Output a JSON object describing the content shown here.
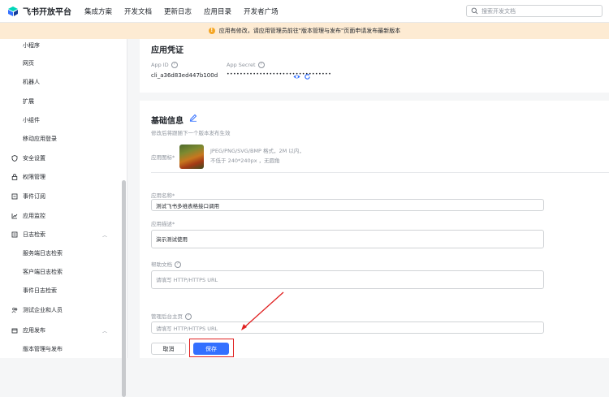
{
  "header": {
    "logo_text": "飞书开放平台",
    "nav": [
      "集成方案",
      "开发文档",
      "更新日志",
      "应用目录",
      "开发者广场"
    ],
    "search_placeholder": "搜索开发文档"
  },
  "notice": {
    "text": "应用有修改，请应用管理员前往\"版本管理与发布\"页面申请发布最新版本",
    "color": "#f5a623"
  },
  "sidebar": {
    "items": [
      {
        "label": "小程序",
        "icon": ""
      },
      {
        "label": "网页",
        "icon": ""
      },
      {
        "label": "机器人",
        "icon": ""
      },
      {
        "label": "扩展",
        "icon": ""
      },
      {
        "label": "小组件",
        "icon": ""
      },
      {
        "label": "移动应用登录",
        "icon": ""
      },
      {
        "label": "安全设置",
        "icon": "shield-icon"
      },
      {
        "label": "权限管理",
        "icon": "lock-icon"
      },
      {
        "label": "事件订阅",
        "icon": "event-icon"
      },
      {
        "label": "应用监控",
        "icon": "chart-icon"
      },
      {
        "label": "日志检索",
        "icon": "log-icon"
      },
      {
        "label": "服务端日志检索",
        "icon": ""
      },
      {
        "label": "客户端日志检索",
        "icon": ""
      },
      {
        "label": "事件日志检索",
        "icon": ""
      },
      {
        "label": "测试企业和人员",
        "icon": "users-icon"
      },
      {
        "label": "应用发布",
        "icon": "publish-icon"
      },
      {
        "label": "版本管理与发布",
        "icon": ""
      }
    ]
  },
  "credentials": {
    "title": "应用凭证",
    "app_id_label": "App ID",
    "app_id_value": "cli_a36d83ed447b100d",
    "app_secret_label": "App Secret",
    "app_secret_value": "••••••••••••••••••••••••••••••••"
  },
  "basic_info": {
    "title": "基础信息",
    "hint": "修改后将跟随下一个版本发布生效",
    "icon_label": "应用图标*",
    "icon_hint_1": "JPEG/PNG/SVG/BMP 格式，2M 以内，",
    "icon_hint_2": "不低于 240*240px ，无圆角",
    "name_label": "应用名称*",
    "name_value": "测试飞书多维表格接口调用",
    "desc_label": "应用描述*",
    "desc_value": "演示测试使用",
    "help_label": "帮助文档",
    "help_placeholder": "请填写 HTTP/HTTPS URL",
    "admin_label": "管理后台主页",
    "admin_placeholder": "请填写 HTTP/HTTPS URL",
    "cancel_label": "取消",
    "save_label": "保存"
  },
  "colors": {
    "accent": "#3370ff",
    "annotation": "#e02020",
    "notice_bg": "#fdebd3"
  }
}
